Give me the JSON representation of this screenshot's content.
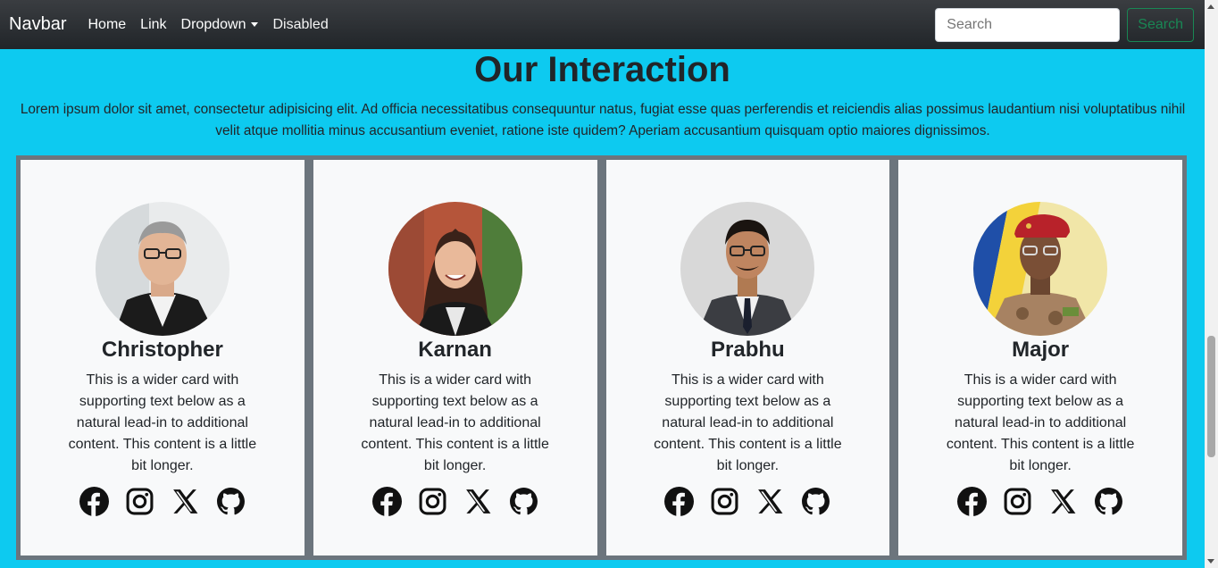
{
  "navbar": {
    "brand": "Navbar",
    "links": [
      "Home",
      "Link",
      "Dropdown",
      "Disabled"
    ],
    "search_placeholder": "Search",
    "search_button": "Search"
  },
  "section": {
    "title": "Our Interaction",
    "intro": "Lorem ipsum dolor sit amet, consectetur adipisicing elit. Ad officia necessitatibus consequuntur natus, fugiat esse quas perferendis et reiciendis alias possimus laudantium nisi voluptatibus nihil velit atque mollitia minus accusantium eveniet, ratione iste quidem? Aperiam accusantium quisquam optio maiores dignissimos."
  },
  "cards": [
    {
      "name": "Christopher",
      "text": "This is a wider card with supporting text below as a natural lead-in to additional content. This content is a little bit longer."
    },
    {
      "name": "Karnan",
      "text": "This is a wider card with supporting text below as a natural lead-in to additional content. This content is a little bit longer."
    },
    {
      "name": "Prabhu",
      "text": "This is a wider card with supporting text below as a natural lead-in to additional content. This content is a little bit longer."
    },
    {
      "name": "Major",
      "text": "This is a wider card with supporting text below as a natural lead-in to additional content. This content is a little bit longer."
    }
  ],
  "social_icons": [
    "facebook-icon",
    "instagram-icon",
    "x-icon",
    "github-icon"
  ],
  "colors": {
    "page_background": "#0dcaf0",
    "navbar_background": "#212529",
    "card_background": "#f8f9fa",
    "card_border": "#6c757d",
    "search_button": "#198754"
  }
}
